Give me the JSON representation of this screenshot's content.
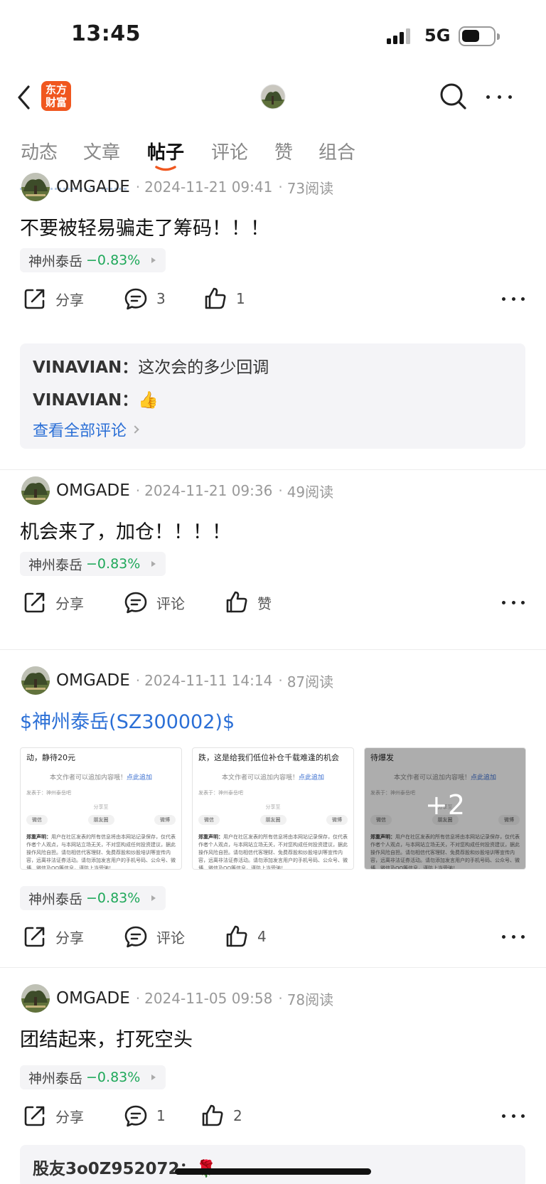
{
  "status_bar": {
    "time": "13:45",
    "network": "5G"
  },
  "app": {
    "logo_line1": "东方",
    "logo_line2": "财富"
  },
  "tabs": [
    {
      "label": "动态"
    },
    {
      "label": "文章"
    },
    {
      "label": "帖子"
    },
    {
      "label": "评论"
    },
    {
      "label": "赞"
    },
    {
      "label": "组合"
    }
  ],
  "active_tab": "帖子",
  "colors": {
    "accent": "#f0571f",
    "link": "#2b6fd6",
    "down": "#1fa85a"
  },
  "posts": [
    {
      "author": "OMGADE",
      "date": "2024-11-21 09:41",
      "reads": "73阅读",
      "title": "不要被轻易骗走了筹码！！！",
      "stock_name": "神州泰岳",
      "stock_change": "−0.83%",
      "share": "分享",
      "comment": "3",
      "like": "1",
      "comments": [
        {
          "user": "VINAVIAN：",
          "text": "这次会的多少回调"
        },
        {
          "user": "VINAVIAN：",
          "text": "👍"
        }
      ],
      "view_all": "查看全部评论"
    },
    {
      "author": "OMGADE",
      "date": "2024-11-21 09:36",
      "reads": "49阅读",
      "title": "机会来了，加仓！！！！",
      "stock_name": "神州泰岳",
      "stock_change": "−0.83%",
      "share": "分享",
      "comment": "评论",
      "like": "赞"
    },
    {
      "author": "OMGADE",
      "date": "2024-11-11 14:14",
      "reads": "87阅读",
      "title": "$神州泰岳(SZ300002)$",
      "stock_name": "神州泰岳",
      "stock_change": "−0.83%",
      "share": "分享",
      "comment": "评论",
      "like": "4",
      "images": [
        {
          "top_text": "动，静待20元"
        },
        {
          "top_text": "跌，这是给我们低位补仓千载难逢的机会"
        },
        {
          "top_text": "待爆发",
          "more": "+2"
        }
      ],
      "image_common": {
        "notice": "本文作者可以追加内容哦！",
        "notice_link": "点此追加",
        "from": "发表于：神州泰岳吧",
        "share_to": "分享至",
        "btn_wechat": "微信",
        "btn_moments": "朋友圈",
        "btn_weibo": "微博",
        "disclaimer_label": "郑重声明：",
        "disclaimer": "用户在社区发表的所有信息将由本网站记录保存，仅代表作者个人观点，与本网站立场无关，不对您构成任何投资建议，据此操作风险自担。请勿相信代客理财、免费荐股和炒股培训等宣传内容，远离非法证券活动。请勿添加发言用户的手机号码、公众号、微博、微信及QQ等信息，谨防上当受骗！"
      }
    },
    {
      "author": "OMGADE",
      "date": "2024-11-05 09:58",
      "reads": "78阅读",
      "title": "团结起来，打死空头",
      "stock_name": "神州泰岳",
      "stock_change": "−0.83%",
      "share": "分享",
      "comment": "1",
      "like": "2",
      "comments": [
        {
          "user": "股友3o0Z952072：",
          "text": "🌹"
        }
      ]
    }
  ]
}
